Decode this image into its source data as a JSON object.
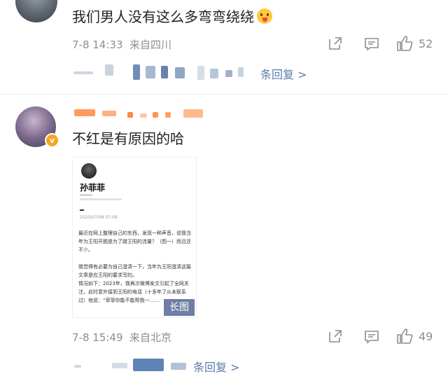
{
  "comment1": {
    "text": "我们男人没有这么多弯弯绕绕",
    "emoji": "tongue-out-emoji",
    "time": "7-8 14:33",
    "location": "来自四川",
    "likes": "52",
    "replies_label": "条回复 >"
  },
  "comment2": {
    "text": "不红是有原因的哈",
    "time": "7-8 15:49",
    "location": "来自北京",
    "likes": "49",
    "replies_label": "条回复 >",
    "verified_badge": "v",
    "image": {
      "author": "孙菲菲",
      "date": "2025/07/08 07:09",
      "paragraphs": [
        "最近在网上整理自己的东西，发现一种声音，说我当年为王阳开脱是为了蹭王阳的流量？（图一）而且还不少。",
        "我觉得有必要为自己澄清一下，当年为王阳澄清这篇文章是应王阳的要求写的。",
        "情况如下：2023年，我再次微博发文引起了全网关注，此时意外接到王阳的电话（十多年了从未联系过）他说：“菲菲你能不能帮我一……"
      ],
      "badge": "长图"
    }
  },
  "colors": {
    "meta_gray": "#8e8e8e",
    "reply_blue": "#5b7ba6",
    "badge_orange": "#f5a623"
  }
}
